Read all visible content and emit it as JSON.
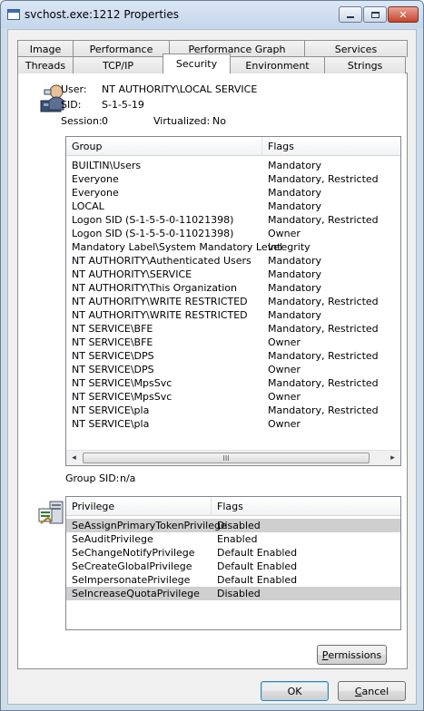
{
  "window": {
    "title": "svchost.exe:1212 Properties"
  },
  "titlebar_buttons": {
    "minimize": "—",
    "maximize": "□",
    "close": "✕"
  },
  "tabs": {
    "row1": [
      "Image",
      "Performance",
      "Performance Graph",
      "Services"
    ],
    "row2": [
      "Threads",
      "TCP/IP",
      "Security",
      "Environment",
      "Strings"
    ],
    "active": "Security"
  },
  "security": {
    "user_label": "User:",
    "user_value": "NT AUTHORITY\\LOCAL SERVICE",
    "sid_label": "SID:",
    "sid_value": "S-1-5-19",
    "session_label": "Session:",
    "session_value": "0",
    "virtualized_label": "Virtualized:",
    "virtualized_value": "No",
    "group_sid_label": "Group SID:",
    "group_sid_value": "n/a"
  },
  "groups": {
    "columns": [
      "Group",
      "Flags"
    ],
    "rows": [
      {
        "group": "BUILTIN\\Users",
        "flags": "Mandatory"
      },
      {
        "group": "Everyone",
        "flags": "Mandatory, Restricted"
      },
      {
        "group": "Everyone",
        "flags": "Mandatory"
      },
      {
        "group": "LOCAL",
        "flags": "Mandatory"
      },
      {
        "group": "Logon SID (S-1-5-5-0-11021398)",
        "flags": "Mandatory, Restricted"
      },
      {
        "group": "Logon SID (S-1-5-5-0-11021398)",
        "flags": "Owner"
      },
      {
        "group": "Mandatory Label\\System Mandatory Level",
        "flags": "Integrity"
      },
      {
        "group": "NT AUTHORITY\\Authenticated Users",
        "flags": "Mandatory"
      },
      {
        "group": "NT AUTHORITY\\SERVICE",
        "flags": "Mandatory"
      },
      {
        "group": "NT AUTHORITY\\This Organization",
        "flags": "Mandatory"
      },
      {
        "group": "NT AUTHORITY\\WRITE RESTRICTED",
        "flags": "Mandatory, Restricted"
      },
      {
        "group": "NT AUTHORITY\\WRITE RESTRICTED",
        "flags": "Mandatory"
      },
      {
        "group": "NT SERVICE\\BFE",
        "flags": "Mandatory, Restricted"
      },
      {
        "group": "NT SERVICE\\BFE",
        "flags": "Owner"
      },
      {
        "group": "NT SERVICE\\DPS",
        "flags": "Mandatory, Restricted"
      },
      {
        "group": "NT SERVICE\\DPS",
        "flags": "Owner"
      },
      {
        "group": "NT SERVICE\\MpsSvc",
        "flags": "Mandatory, Restricted"
      },
      {
        "group": "NT SERVICE\\MpsSvc",
        "flags": "Owner"
      },
      {
        "group": "NT SERVICE\\pla",
        "flags": "Mandatory, Restricted"
      },
      {
        "group": "NT SERVICE\\pla",
        "flags": "Owner"
      }
    ],
    "scroll_thumb_glyph": "III"
  },
  "privileges": {
    "columns": [
      "Privilege",
      "Flags"
    ],
    "rows": [
      {
        "privilege": "SeAssignPrimaryTokenPrivilege",
        "flags": "Disabled",
        "selected": true
      },
      {
        "privilege": "SeAuditPrivilege",
        "flags": "Enabled",
        "selected": false
      },
      {
        "privilege": "SeChangeNotifyPrivilege",
        "flags": "Default Enabled",
        "selected": false
      },
      {
        "privilege": "SeCreateGlobalPrivilege",
        "flags": "Default Enabled",
        "selected": false
      },
      {
        "privilege": "SeImpersonatePrivilege",
        "flags": "Default Enabled",
        "selected": false
      },
      {
        "privilege": "SeIncreaseQuotaPrivilege",
        "flags": "Disabled",
        "selected": true
      }
    ]
  },
  "buttons": {
    "permissions": {
      "pre": "",
      "accel": "P",
      "post": "ermissions"
    },
    "ok": "OK",
    "cancel": {
      "pre": "",
      "accel": "C",
      "post": "ancel"
    }
  },
  "colors": {
    "selected_row": "#cfcfcf",
    "window_frame": "#cfdcea"
  }
}
